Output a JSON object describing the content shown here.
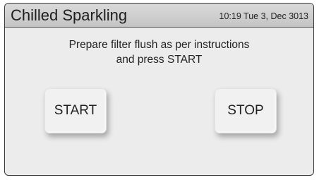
{
  "header": {
    "title": "Chilled Sparkling",
    "datetime": "10:19 Tue 3, Dec 3013"
  },
  "main": {
    "message_line1": "Prepare filter flush as per instructions",
    "message_line2": "and press START"
  },
  "buttons": {
    "start_label": "START",
    "stop_label": "STOP"
  },
  "colors": {
    "screen_background": "#ececec",
    "header_background": "#cfcfcf",
    "border": "#3a3a3a",
    "button_background": "#f1f1f1",
    "text": "#222222"
  }
}
